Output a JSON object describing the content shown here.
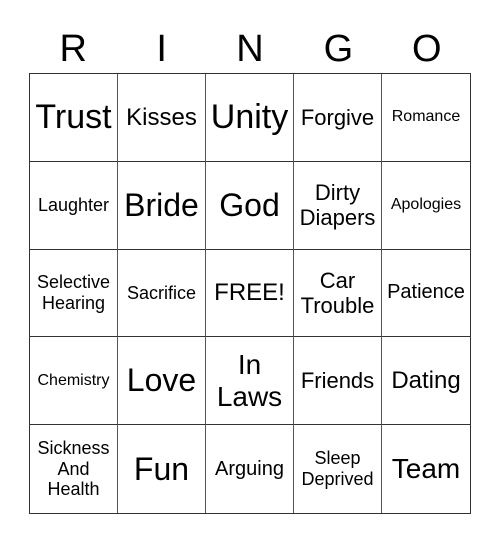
{
  "header": [
    "R",
    "I",
    "N",
    "G",
    "O"
  ],
  "cells": [
    "Trust",
    "Kisses",
    "Unity",
    "Forgive",
    "Romance",
    "Laughter",
    "Bride",
    "God",
    "Dirty\nDiapers",
    "Apologies",
    "Selective\nHearing",
    "Sacrifice",
    "FREE!",
    "Car\nTrouble",
    "Patience",
    "Chemistry",
    "Love",
    "In\nLaws",
    "Friends",
    "Dating",
    "Sickness\nAnd\nHealth",
    "Fun",
    "Arguing",
    "Sleep\nDeprived",
    "Team"
  ]
}
